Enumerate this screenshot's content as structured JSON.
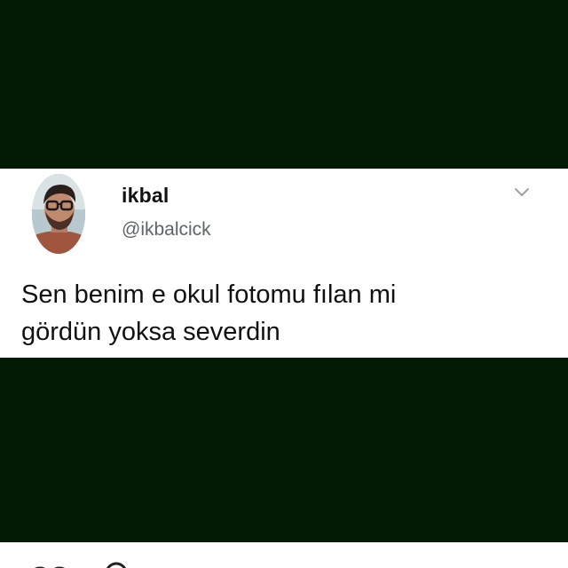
{
  "tweet": {
    "display_name": "ikbal",
    "handle": "@ikbalcick",
    "text": "Sen benim e okul fotomu fılan mi\ngördün yoksa severdin"
  },
  "icons": {
    "menu": "chevron-down-icon",
    "avatar": "profile-photo"
  },
  "colors": {
    "background": "#011b04",
    "card": "#ffffff",
    "name": "#111111",
    "handle": "#5f6368"
  }
}
